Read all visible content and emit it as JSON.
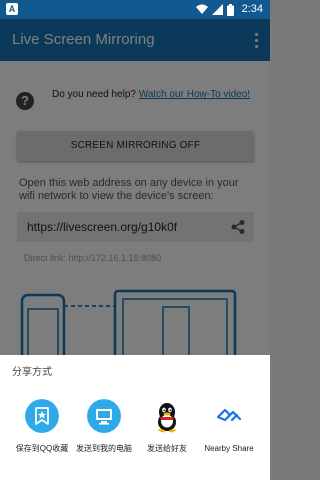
{
  "status_bar": {
    "left_badge": "A",
    "time": "2:34"
  },
  "app_bar": {
    "title": "Live Screen Mirroring"
  },
  "help": {
    "prompt": "Do you need help?",
    "link": "Watch our How-To video!"
  },
  "mirror_button_label": "SCREEN MIRRORING OFF",
  "instructions": "Open this web address on any device in your wifi network to view the device's screen:",
  "url": "https://livescreen.org/g10k0f",
  "direct_link": "Direct link: http://172.16.1.15:8080",
  "share_sheet": {
    "title": "分享方式",
    "targets": [
      {
        "label": "保存到QQ收藏",
        "icon": "qq-favorites-star-icon",
        "color": "#2eaae8"
      },
      {
        "label": "发送到我的电脑",
        "icon": "send-to-computer-icon",
        "color": "#2eaae8"
      },
      {
        "label": "发送给好友",
        "icon": "qq-penguin-icon",
        "color": "#000000"
      },
      {
        "label": "Nearby Share",
        "icon": "nearby-share-icon",
        "color": "#1a73e8"
      }
    ]
  },
  "colors": {
    "status_bar": "#12598f",
    "app_bar": "#1773b3",
    "link": "#1773b3",
    "illustration": "#1773b3"
  }
}
